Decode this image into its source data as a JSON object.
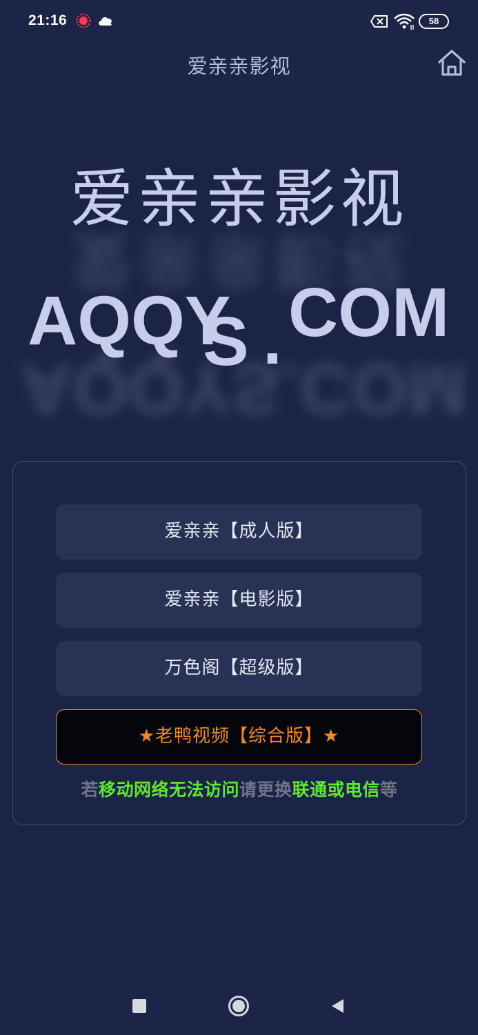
{
  "status_bar": {
    "time": "21:16",
    "icons": [
      "record-icon",
      "cloud-icon",
      "sim-x-icon",
      "wifi-icon"
    ],
    "battery": "58"
  },
  "header": {
    "title": "爱亲亲影视",
    "home_icon": "home-icon"
  },
  "hero": {
    "title": "爱亲亲影视",
    "domain_part1": "AQQY",
    "domain_part2": "S",
    "domain_part3": ".",
    "domain_part4": "COM",
    "domain_reflection": "AQQYS.COM"
  },
  "links": [
    {
      "label": "爱亲亲【成人版】"
    },
    {
      "label": "爱亲亲【电影版】"
    },
    {
      "label": "万色阁【超级版】"
    },
    {
      "label": "★老鸭视频【综合版】★"
    }
  ],
  "notice": {
    "part1": "若",
    "part2": "移动网络无法访问",
    "part3": "请更换",
    "part4": "联通或电信",
    "part5": "等"
  },
  "colors": {
    "background": "#1b2447",
    "button": "#283255",
    "highlight": "#f08a25",
    "notice_green": "#5fe82d",
    "notice_gray": "#6f7585"
  },
  "nav_bar": {
    "icons": [
      "recents-square-icon",
      "home-circle-icon",
      "back-triangle-icon"
    ]
  }
}
